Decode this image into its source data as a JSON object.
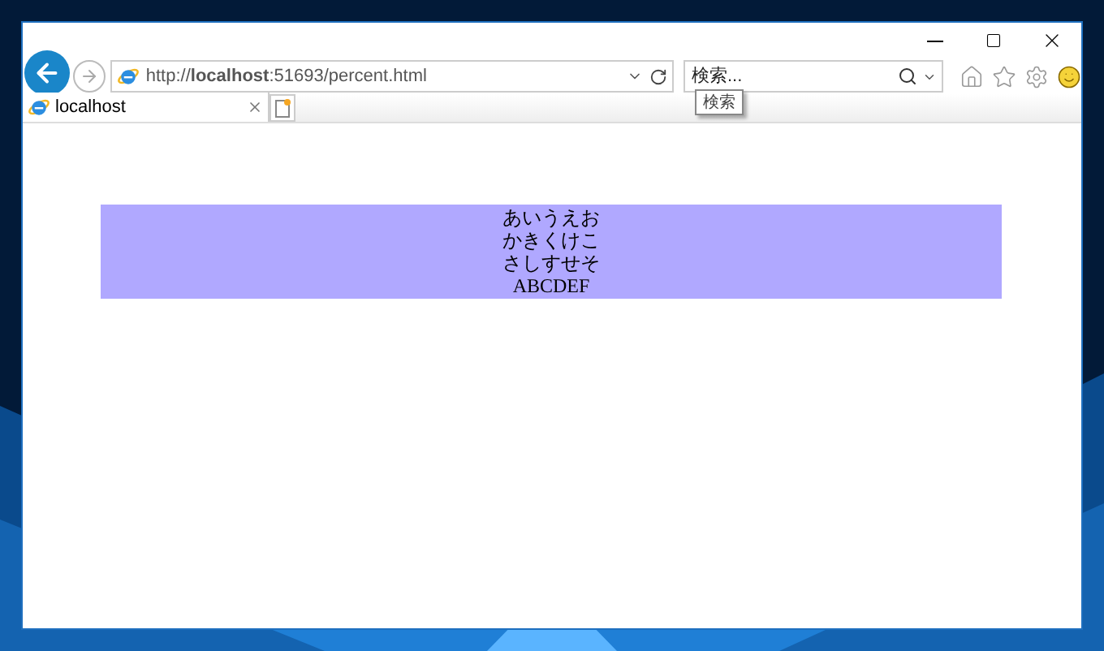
{
  "address_bar": {
    "url": "http://**localhost**:51693/percent.html"
  },
  "search": {
    "placeholder": "検索..."
  },
  "tooltip": "検索",
  "tabs": [
    {
      "label": "localhost",
      "selected": true
    }
  ],
  "page": {
    "lines": [
      "あいうえお",
      "かきくけこ",
      "さしすせそ",
      "ABCDEF"
    ]
  }
}
